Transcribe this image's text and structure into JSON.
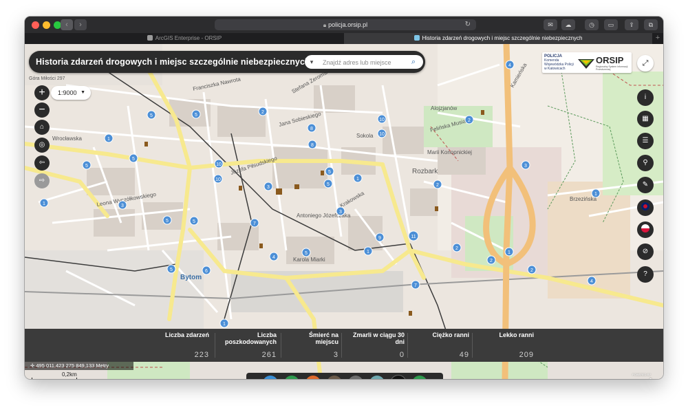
{
  "browser": {
    "url": "policja.orsip.pl",
    "tabs": [
      {
        "label": "ArcGIS Enterprise - ORSIP",
        "active": false
      },
      {
        "label": "Historia zdarzeń drogowych i miejsc szczególnie niebezpiecznych",
        "active": true
      }
    ],
    "new_tab": "+"
  },
  "app": {
    "title": "Historia zdarzeń drogowych i miejsc szczególnie niebezpiecznych",
    "search_placeholder": "Znajdź adres lub miejsce",
    "scale": "1:9000",
    "logo_policja": "POLICJA",
    "logo_policja_sub": "Komenda Wojewódzka Policji w Katowicach",
    "logo_orsip": "ORSIP",
    "logo_orsip_sub": "Regionalny System Informacji Przestrzennej",
    "coords": "495 011,423 275 849,133 Metry",
    "scale_bar": "0,2km",
    "esri_powered": "POWERED BY",
    "esri_label": "esri",
    "accent": "#2b2b2b"
  },
  "stats": [
    {
      "label": "Liczba zdarzeń",
      "value": "223"
    },
    {
      "label": "Liczba poszkodowanych",
      "value": "261"
    },
    {
      "label": "Śmierć na miejscu",
      "value": "3"
    },
    {
      "label": "Zmarli w ciągu 30 dni",
      "value": "0"
    },
    {
      "label": "Ciężko ranni",
      "value": "49"
    },
    {
      "label": "Lekko ranni",
      "value": "209"
    }
  ],
  "map_labels": {
    "street_1": "Wrocławska",
    "street_2": "Józefa Piłsudskiego",
    "street_3": "Karola Miarki",
    "street_4": "Jana Sobieskiego",
    "street_5": "Leona Wyczółkowskiego",
    "street_6": "Bytom",
    "street_7": "Rozbark",
    "street_8": "Brzezińska",
    "street_9": "Alojzjanów",
    "street_10": "Krakowska",
    "street_11": "Antoniego Józefczaka",
    "street_12": "Felińska Musialika",
    "street_13": "Marii Konopnickiej",
    "street_14": "Franciszka Nawrota",
    "street_15": "Stefana Żeromskiego",
    "street_16": "Sokola",
    "street_17": "Góra Miłości 297",
    "street_18": "Kamieńska"
  },
  "map_markers": [
    {
      "n": "5",
      "kind": "cluster"
    },
    {
      "n": "2",
      "kind": "cluster"
    },
    {
      "n": "4",
      "kind": "cluster"
    },
    {
      "n": "7",
      "kind": "cluster"
    },
    {
      "n": "1",
      "kind": "cluster"
    },
    {
      "n": "3",
      "kind": "cluster"
    },
    {
      "n": "10",
      "kind": "cluster"
    },
    {
      "n": "8",
      "kind": "cluster"
    },
    {
      "n": "6",
      "kind": "cluster"
    },
    {
      "n": "9",
      "kind": "cluster"
    },
    {
      "n": "11",
      "kind": "cluster"
    }
  ],
  "colors": {
    "map_bg": "#ece6df",
    "road_major": "#f7e98e",
    "road_orange": "#f2c07a",
    "marker": "#4c8fd6",
    "green_area": "#cfe8c2",
    "stats_bar": "#3b3b3b"
  },
  "toolbar_items": [
    {
      "icon": "layers-icon",
      "color": "#3a8fd6"
    },
    {
      "icon": "legend-icon",
      "color": "#2e9b4e"
    },
    {
      "icon": "filter-icon",
      "color": "#e06a2b"
    },
    {
      "icon": "widgets-icon",
      "color": "#6b5a4a"
    },
    {
      "icon": "print-icon",
      "color": "#6d6d6d"
    },
    {
      "icon": "measure-icon",
      "color": "#6fa9b0"
    },
    {
      "icon": "eye-icon",
      "color": "#111111"
    },
    {
      "icon": "search-icon",
      "color": "#2e9b4e"
    }
  ],
  "right_tools": [
    "info-icon",
    "grid-icon",
    "table-icon",
    "chart-icon",
    "message-icon",
    "flag-uk-icon",
    "flag-pl-icon",
    "compass-icon",
    "help-icon"
  ]
}
